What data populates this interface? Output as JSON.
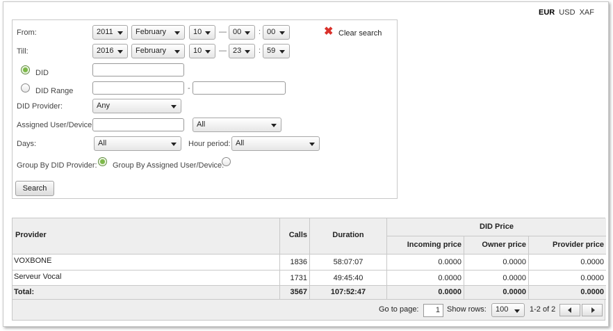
{
  "currency": {
    "options": [
      "EUR",
      "USD",
      "XAF"
    ],
    "active": "EUR"
  },
  "search": {
    "from_label": "From:",
    "till_label": "Till:",
    "from": {
      "year": "2011",
      "month": "February",
      "day": "10",
      "hour": "00",
      "minute": "00"
    },
    "till": {
      "year": "2016",
      "month": "February",
      "day": "10",
      "hour": "23",
      "minute": "59"
    },
    "date_sep": "—",
    "time_sep": ":",
    "clear_label": "Clear search",
    "did_label": "DID",
    "did_value": "",
    "did_range_label": "DID Range",
    "did_range_from": "",
    "did_range_to": "",
    "range_sep": "-",
    "did_provider_label": "DID Provider:",
    "did_provider_value": "Any",
    "assigned_label": "Assigned User/Device:",
    "assigned_value": "",
    "assigned_select": "All",
    "days_label": "Days:",
    "days_value": "All",
    "hour_period_label": "Hour period:",
    "hour_period_value": "All",
    "group_by_provider_label": "Group By DID Provider:",
    "group_by_user_label": "Group By Assigned User/Device:",
    "search_button": "Search"
  },
  "table": {
    "headers": {
      "provider": "Provider",
      "calls": "Calls",
      "duration": "Duration",
      "did_price": "DID Price",
      "incoming": "Incoming price",
      "owner": "Owner price",
      "provider_price": "Provider price"
    },
    "rows": [
      {
        "provider": "VOXBONE",
        "calls": "1836",
        "duration": "58:07:07",
        "incoming": "0.0000",
        "owner": "0.0000",
        "provider_price": "0.0000"
      },
      {
        "provider": "Serveur Vocal",
        "calls": "1731",
        "duration": "49:45:40",
        "incoming": "0.0000",
        "owner": "0.0000",
        "provider_price": "0.0000"
      }
    ],
    "total": {
      "label": "Total:",
      "calls": "3567",
      "duration": "107:52:47",
      "incoming": "0.0000",
      "owner": "0.0000",
      "provider_price": "0.0000"
    },
    "pager": {
      "go_to_label": "Go to page:",
      "page": "1",
      "show_rows_label": "Show rows:",
      "rows_value": "100",
      "range": "1-2 of 2"
    }
  }
}
